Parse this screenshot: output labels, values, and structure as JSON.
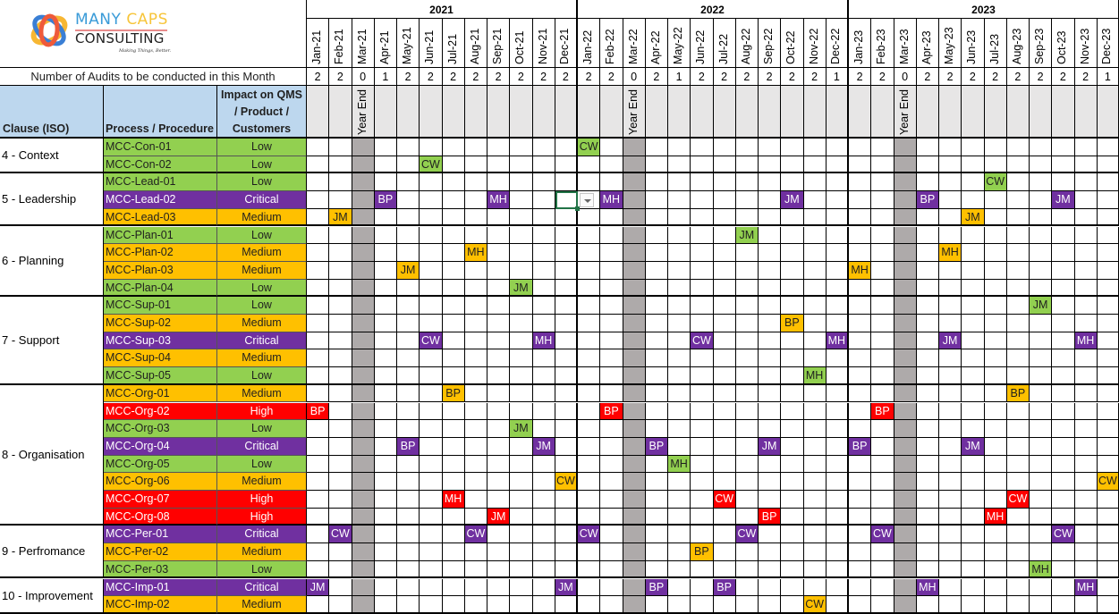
{
  "logo": {
    "word1": "MANY",
    "word2": "CAPS",
    "word3": "CONSULTING",
    "tagline": "Making Things, Better."
  },
  "count_row_label": "Number of Audits to be conducted  in this Month",
  "headers": {
    "clause": "Clause (ISO)",
    "process": "Process / Procedure",
    "impact_lines": [
      "Impact on QMS",
      "/ Product /",
      "Customers"
    ]
  },
  "year_end_label": "Year End",
  "years": [
    {
      "label": "2021",
      "months": [
        "Jan-21",
        "Feb-21",
        "Mar-21",
        "Apr-21",
        "May-21",
        "Jun-21",
        "Jul-21",
        "Aug-21",
        "Sep-21",
        "Oct-21",
        "Nov-21",
        "Dec-21"
      ],
      "counts": [
        "2",
        "2",
        "0",
        "1",
        "2",
        "2",
        "2",
        "2",
        "2",
        "2",
        "2",
        "2"
      ]
    },
    {
      "label": "2022",
      "months": [
        "Jan-22",
        "Feb-22",
        "Mar-22",
        "Apr-22",
        "May-22",
        "Jun-22",
        "Jul-22",
        "Aug-22",
        "Sep-22",
        "Oct-22",
        "Nov-22",
        "Dec-22"
      ],
      "counts": [
        "2",
        "2",
        "0",
        "2",
        "1",
        "2",
        "2",
        "2",
        "2",
        "2",
        "2",
        "1"
      ]
    },
    {
      "label": "2023",
      "months": [
        "Jan-23",
        "Feb-23",
        "Mar-23",
        "Apr-23",
        "May-23",
        "Jun-23",
        "Jul-23",
        "Aug-23",
        "Sep-23",
        "Oct-23",
        "Nov-23",
        "Dec-23"
      ],
      "counts": [
        "2",
        "2",
        "0",
        "2",
        "2",
        "2",
        "2",
        "2",
        "2",
        "2",
        "2",
        "1"
      ]
    }
  ],
  "impact_colors": {
    "Low": {
      "bg": "#92d050",
      "fg": "#1f1f1f"
    },
    "Medium": {
      "bg": "#ffc000",
      "fg": "#1f1f1f"
    },
    "High": {
      "bg": "#ff0000",
      "fg": "#ffffff"
    },
    "Critical": {
      "bg": "#7030a0",
      "fg": "#ffffff"
    }
  },
  "clauses": [
    {
      "label": "4 - Context",
      "rows": [
        {
          "process": "MCC-Con-01",
          "impact": "Low",
          "audits": {
            "Jan-22": "CW"
          }
        },
        {
          "process": "MCC-Con-02",
          "impact": "Low",
          "audits": {
            "Jun-21": "CW"
          }
        }
      ]
    },
    {
      "label": "5 - Leadership",
      "rows": [
        {
          "process": "MCC-Lead-01",
          "impact": "Low",
          "audits": {
            "Jul-23": "CW"
          }
        },
        {
          "process": "MCC-Lead-02",
          "impact": "Critical",
          "audits": {
            "Apr-21": "BP",
            "Sep-21": "MH",
            "Feb-22": "MH",
            "Oct-22": "JM",
            "Apr-23": "BP",
            "Oct-23": "JM"
          }
        },
        {
          "process": "MCC-Lead-03",
          "impact": "Medium",
          "audits": {
            "Feb-21": "JM",
            "Jun-23": "JM"
          }
        }
      ]
    },
    {
      "label": "6 - Planning",
      "rows": [
        {
          "process": "MCC-Plan-01",
          "impact": "Low",
          "audits": {
            "Aug-22": "JM"
          }
        },
        {
          "process": "MCC-Plan-02",
          "impact": "Medium",
          "audits": {
            "Aug-21": "MH",
            "May-23": "MH"
          }
        },
        {
          "process": "MCC-Plan-03",
          "impact": "Medium",
          "audits": {
            "May-21": "JM",
            "Jan-23": "MH"
          }
        },
        {
          "process": "MCC-Plan-04",
          "impact": "Low",
          "audits": {
            "Oct-21": "JM"
          }
        }
      ]
    },
    {
      "label": "7 - Support",
      "rows": [
        {
          "process": "MCC-Sup-01",
          "impact": "Low",
          "audits": {
            "Sep-23": "JM"
          }
        },
        {
          "process": "MCC-Sup-02",
          "impact": "Medium",
          "audits": {
            "Oct-22": "BP"
          }
        },
        {
          "process": "MCC-Sup-03",
          "impact": "Critical",
          "audits": {
            "Jun-21": "CW",
            "Nov-21": "MH",
            "Jun-22": "CW",
            "Dec-22": "MH",
            "May-23": "JM",
            "Nov-23": "MH"
          }
        },
        {
          "process": "MCC-Sup-04",
          "impact": "Medium",
          "audits": {}
        },
        {
          "process": "MCC-Sup-05",
          "impact": "Low",
          "audits": {
            "Nov-22": "MH"
          }
        }
      ]
    },
    {
      "label": "8 - Organisation",
      "rows": [
        {
          "process": "MCC-Org-01",
          "impact": "Medium",
          "audits": {
            "Jul-21": "BP",
            "Aug-23": "BP"
          }
        },
        {
          "process": "MCC-Org-02",
          "impact": "High",
          "audits": {
            "Jan-21": "BP",
            "Feb-22": "BP",
            "Feb-23": "BP"
          }
        },
        {
          "process": "MCC-Org-03",
          "impact": "Low",
          "audits": {
            "Oct-21": "JM"
          }
        },
        {
          "process": "MCC-Org-04",
          "impact": "Critical",
          "audits": {
            "May-21": "BP",
            "Nov-21": "JM",
            "Apr-22": "BP",
            "Sep-22": "JM",
            "Jan-23": "BP",
            "Jun-23": "JM"
          }
        },
        {
          "process": "MCC-Org-05",
          "impact": "Low",
          "audits": {
            "May-22": "MH"
          }
        },
        {
          "process": "MCC-Org-06",
          "impact": "Medium",
          "audits": {
            "Dec-21": "CW",
            "Dec-23": "CW"
          }
        },
        {
          "process": "MCC-Org-07",
          "impact": "High",
          "audits": {
            "Jul-21": "MH",
            "Jul-22": "CW",
            "Aug-23": "CW"
          }
        },
        {
          "process": "MCC-Org-08",
          "impact": "High",
          "audits": {
            "Sep-21": "JM",
            "Sep-22": "BP",
            "Jul-23": "MH"
          }
        }
      ]
    },
    {
      "label": "9 - Perfromance",
      "rows": [
        {
          "process": "MCC-Per-01",
          "impact": "Critical",
          "audits": {
            "Feb-21": "CW",
            "Aug-21": "CW",
            "Jan-22": "CW",
            "Aug-22": "CW",
            "Feb-23": "CW",
            "Oct-23": "CW"
          }
        },
        {
          "process": "MCC-Per-02",
          "impact": "Medium",
          "audits": {
            "Jun-22": "BP"
          }
        },
        {
          "process": "MCC-Per-03",
          "impact": "Low",
          "audits": {
            "Sep-23": "MH"
          }
        }
      ]
    },
    {
      "label": "10 - Improvement",
      "rows": [
        {
          "process": "MCC-Imp-01",
          "impact": "Critical",
          "audits": {
            "Jan-21": "JM",
            "Dec-21": "JM",
            "Apr-22": "BP",
            "Jul-22": "BP",
            "Apr-23": "MH",
            "Nov-23": "MH"
          }
        },
        {
          "process": "MCC-Imp-02",
          "impact": "Medium",
          "audits": {
            "Nov-22": "CW"
          }
        }
      ]
    }
  ],
  "selected_cell": {
    "process": "MCC-Lead-02",
    "month": "Dec-21",
    "has_dropdown": true
  }
}
